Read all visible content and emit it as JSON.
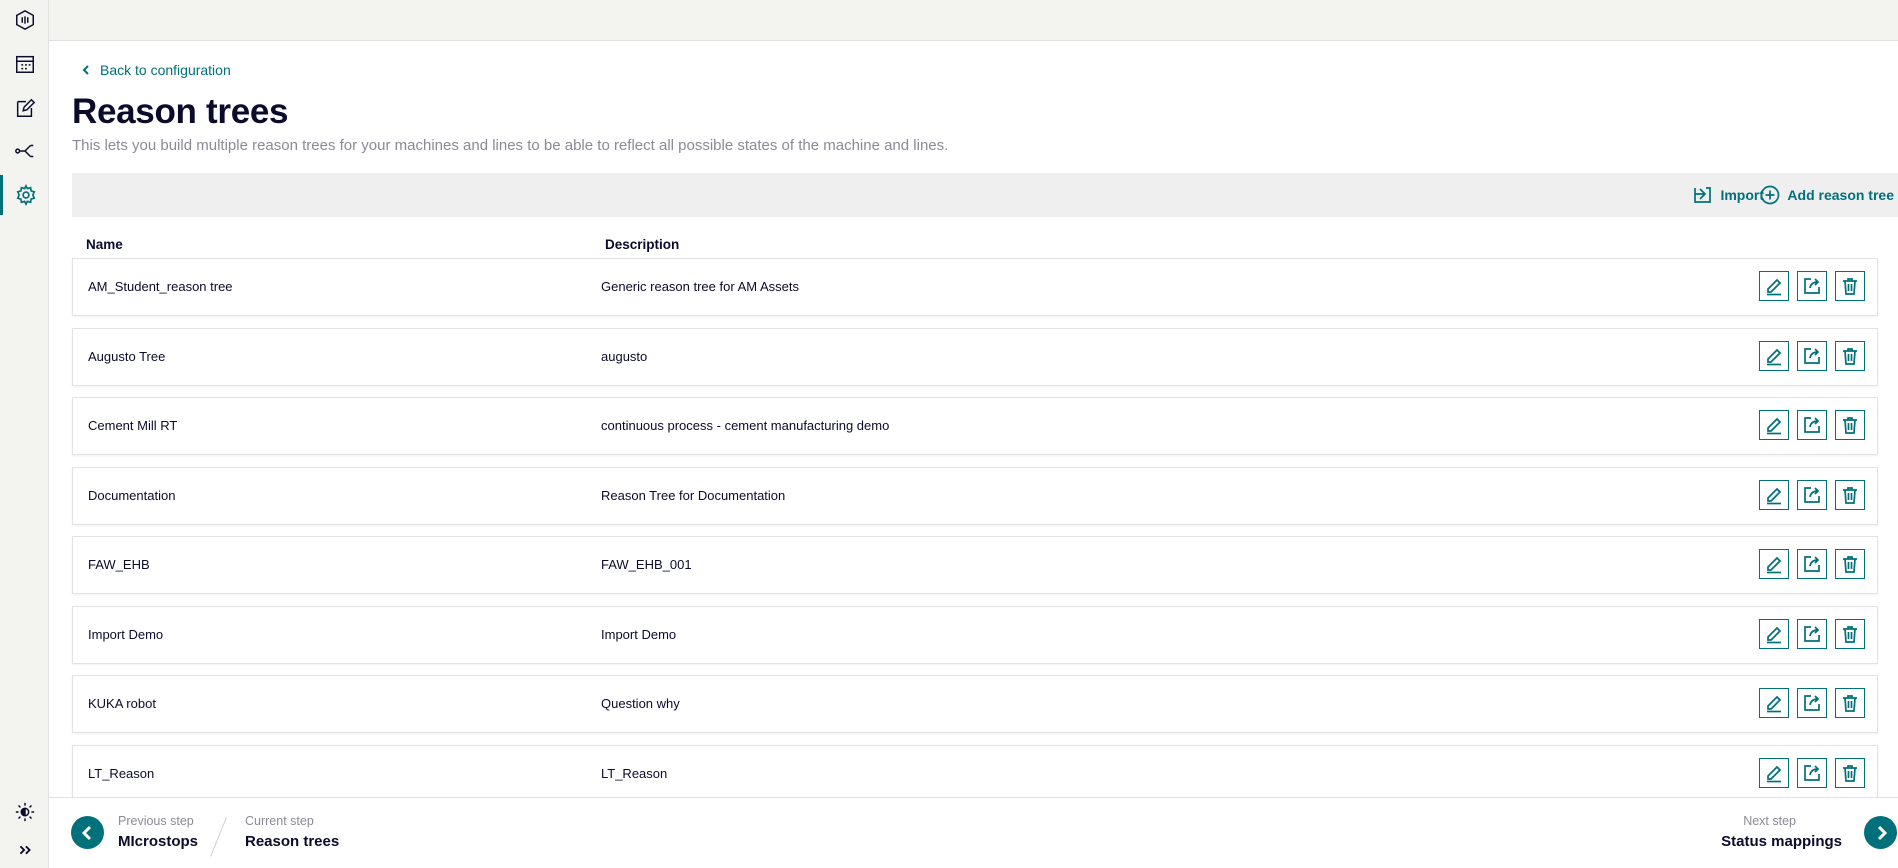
{
  "sidebar": {
    "icons": [
      "app-logo-icon",
      "calendar-icon",
      "edit-note-icon",
      "hierarchy-icon",
      "settings-icon",
      "theme-toggle-icon",
      "expand-icon"
    ],
    "active": "settings-icon"
  },
  "header": {
    "back_label": "Back to configuration",
    "title": "Reason trees",
    "subtitle": "This lets you build multiple reason trees for your machines and lines to be able to reflect all possible states of the machine and lines."
  },
  "toolbar": {
    "import_label": "Import",
    "add_label": "Add reason tree"
  },
  "table": {
    "columns": {
      "name": "Name",
      "description": "Description"
    },
    "rows": [
      {
        "name": "AM_Student_reason tree",
        "description": "Generic reason tree for AM Assets"
      },
      {
        "name": "Augusto Tree",
        "description": "augusto"
      },
      {
        "name": "Cement Mill RT",
        "description": "continuous process - cement manufacturing demo"
      },
      {
        "name": "Documentation",
        "description": "Reason Tree for Documentation"
      },
      {
        "name": "FAW_EHB",
        "description": "FAW_EHB_001"
      },
      {
        "name": "Import Demo",
        "description": "Import Demo"
      },
      {
        "name": "KUKA robot",
        "description": "Question why"
      },
      {
        "name": "LT_Reason",
        "description": "LT_Reason"
      }
    ]
  },
  "footer": {
    "previous_caption": "Previous step",
    "previous_value": "MIcrostops",
    "current_caption": "Current step",
    "current_value": "Reason trees",
    "next_caption": "Next step",
    "next_value": "Status mappings"
  },
  "colors": {
    "accent": "#00707a",
    "text": "#0b0b2b",
    "muted": "#8a8a96",
    "toolbar_bg": "#efefef",
    "sidebar_bg": "#f3f3f0"
  }
}
